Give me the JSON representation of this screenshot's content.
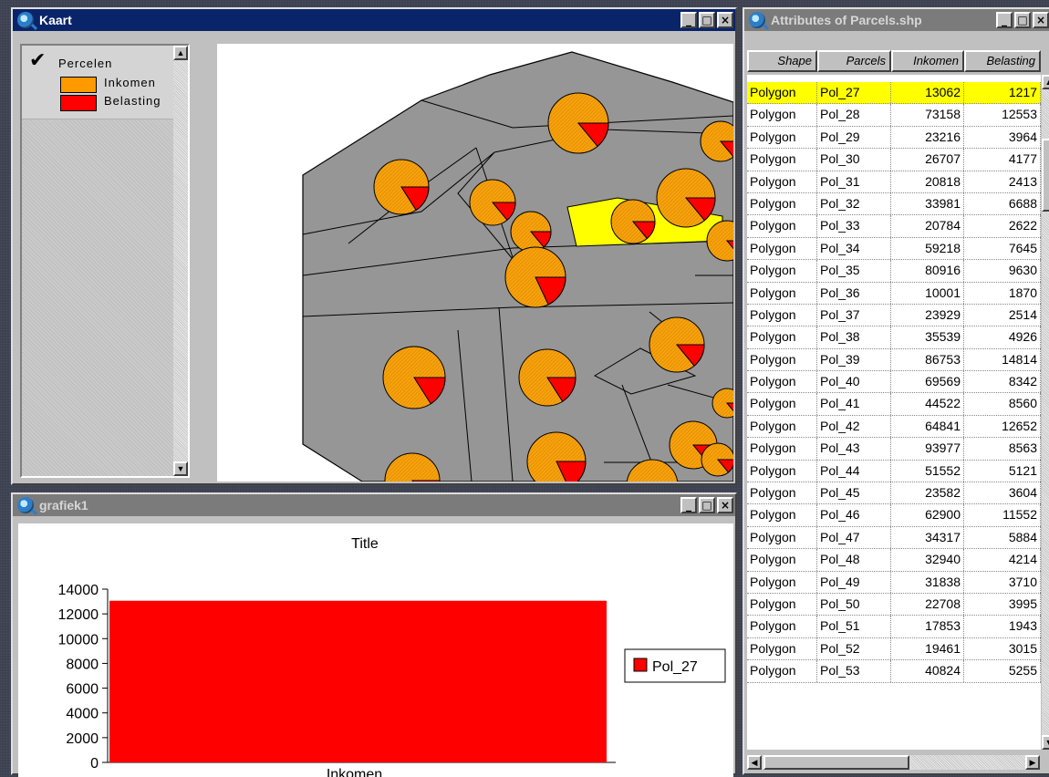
{
  "windows": {
    "kaart": {
      "title": "Kaart"
    },
    "grafiek": {
      "title": "grafiek1"
    },
    "attributes": {
      "title": "Attributes of Parcels.shp"
    }
  },
  "window_buttons": {
    "minimize": "_",
    "maximize": "□",
    "close": "×"
  },
  "legend": {
    "layer_name": "Percelen",
    "layer_checked": true,
    "items": [
      {
        "label": "Inkomen",
        "color": "#ff9900"
      },
      {
        "label": "Belasting",
        "color": "#ff0000"
      }
    ]
  },
  "map": {
    "parcel_fill": "#969696",
    "selected_fill": "#ffff00",
    "pie_income_color": "#f7a20c",
    "pie_tax_color": "#ff0000"
  },
  "table": {
    "columns": [
      "Shape",
      "Parcels",
      "Inkomen",
      "Belasting"
    ],
    "selected_index": 0,
    "rows": [
      [
        "Polygon",
        "Pol_27",
        "13062",
        "1217"
      ],
      [
        "Polygon",
        "Pol_28",
        "73158",
        "12553"
      ],
      [
        "Polygon",
        "Pol_29",
        "23216",
        "3964"
      ],
      [
        "Polygon",
        "Pol_30",
        "26707",
        "4177"
      ],
      [
        "Polygon",
        "Pol_31",
        "20818",
        "2413"
      ],
      [
        "Polygon",
        "Pol_32",
        "33981",
        "6688"
      ],
      [
        "Polygon",
        "Pol_33",
        "20784",
        "2622"
      ],
      [
        "Polygon",
        "Pol_34",
        "59218",
        "7645"
      ],
      [
        "Polygon",
        "Pol_35",
        "80916",
        "9630"
      ],
      [
        "Polygon",
        "Pol_36",
        "10001",
        "1870"
      ],
      [
        "Polygon",
        "Pol_37",
        "23929",
        "2514"
      ],
      [
        "Polygon",
        "Pol_38",
        "35539",
        "4926"
      ],
      [
        "Polygon",
        "Pol_39",
        "86753",
        "14814"
      ],
      [
        "Polygon",
        "Pol_40",
        "69569",
        "8342"
      ],
      [
        "Polygon",
        "Pol_41",
        "44522",
        "8560"
      ],
      [
        "Polygon",
        "Pol_42",
        "64841",
        "12652"
      ],
      [
        "Polygon",
        "Pol_43",
        "93977",
        "8563"
      ],
      [
        "Polygon",
        "Pol_44",
        "51552",
        "5121"
      ],
      [
        "Polygon",
        "Pol_45",
        "23582",
        "3604"
      ],
      [
        "Polygon",
        "Pol_46",
        "62900",
        "11552"
      ],
      [
        "Polygon",
        "Pol_47",
        "34317",
        "5884"
      ],
      [
        "Polygon",
        "Pol_48",
        "32940",
        "4214"
      ],
      [
        "Polygon",
        "Pol_49",
        "31838",
        "3710"
      ],
      [
        "Polygon",
        "Pol_50",
        "22708",
        "3995"
      ],
      [
        "Polygon",
        "Pol_51",
        "17853",
        "1943"
      ],
      [
        "Polygon",
        "Pol_52",
        "19461",
        "3015"
      ],
      [
        "Polygon",
        "Pol_53",
        "40824",
        "5255"
      ]
    ]
  },
  "chart_data": {
    "type": "bar",
    "title": "Title",
    "categories": [
      "Inkomen"
    ],
    "series": [
      {
        "name": "Pol_27",
        "values": [
          13062
        ],
        "color": "#ff0000"
      }
    ],
    "ylim": [
      0,
      14000
    ],
    "yticks": [
      "14000",
      "12000",
      "10000",
      "8000",
      "6000",
      "4000",
      "2000",
      "0"
    ],
    "legend_position": "right"
  }
}
